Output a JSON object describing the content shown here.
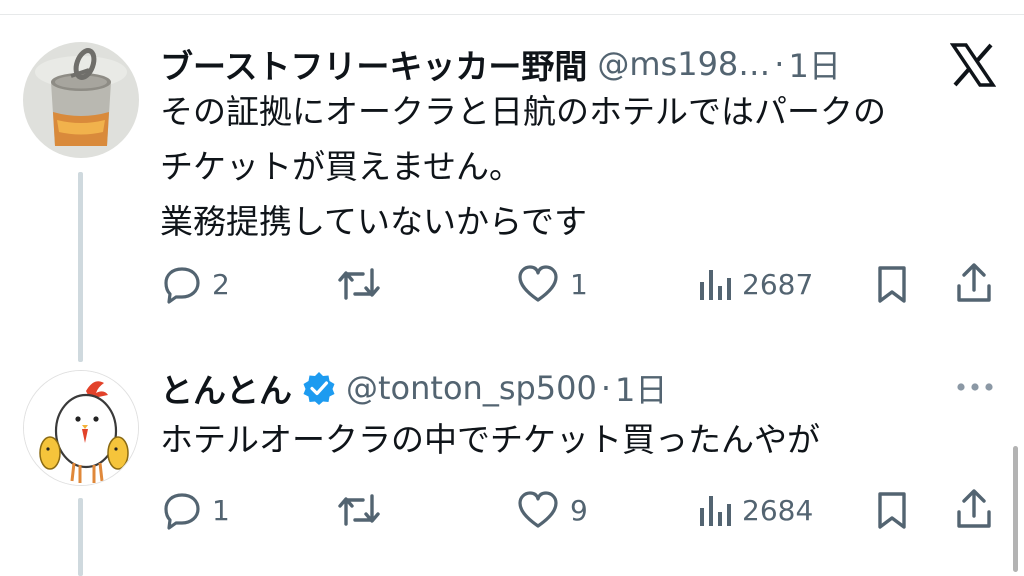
{
  "brand_icon": "x-logo-icon",
  "tweets": [
    {
      "name": "ブーストフリーキッカー野間",
      "handle": "@ms198…",
      "separator": "·",
      "time": "1日",
      "verified": false,
      "text_lines": [
        "その証拠にオークラと日航のホテルではパークの",
        "チケットが買えません。",
        "業務提携していないからです"
      ],
      "actions": {
        "replies": "2",
        "retweets": "",
        "likes": "1",
        "views": "2687"
      }
    },
    {
      "name": "とんとん",
      "handle": "@tonton_sp500",
      "separator": "·",
      "time": "1日",
      "verified": true,
      "text_lines": [
        "ホテルオークラの中でチケット買ったんやが"
      ],
      "actions": {
        "replies": "1",
        "retweets": "",
        "likes": "9",
        "views": "2684"
      }
    }
  ],
  "colors": {
    "text_primary": "#0f1419",
    "text_secondary": "#536471",
    "verified_blue": "#1d9bf0",
    "thread_line": "#cfd9de"
  }
}
